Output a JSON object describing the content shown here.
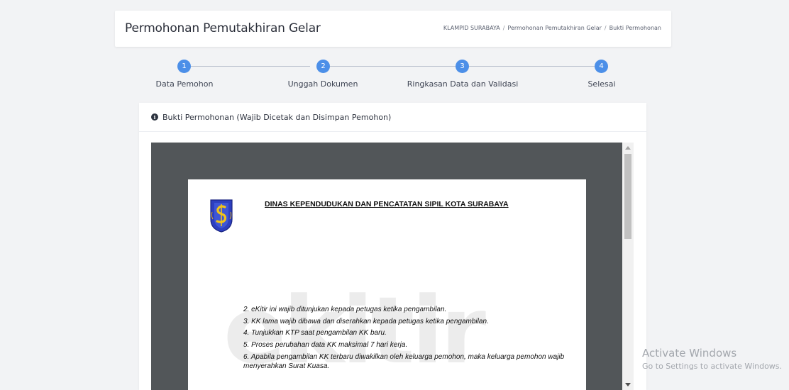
{
  "header": {
    "title": "Permohonan Pemutakhiran Gelar",
    "breadcrumb": [
      "KLAMPID SURABAYA",
      "Permohonan Pemutakhiran Gelar",
      "Bukti Permohonan"
    ],
    "breadcrumb_separator": "/"
  },
  "stepper": {
    "steps": [
      {
        "number": "1",
        "label": "Data Pemohon"
      },
      {
        "number": "2",
        "label": "Unggah Dokumen"
      },
      {
        "number": "3",
        "label": "Ringkasan Data dan Validasi"
      },
      {
        "number": "4",
        "label": "Selesai"
      }
    ],
    "active_color": "#4c8fe8"
  },
  "card": {
    "icon": "info-circle-icon",
    "title": "Bukti Permohonan (Wajib Dicetak dan Disimpan Pemohon)"
  },
  "document": {
    "heading": "DINAS KEPENDUDUKAN DAN PENCATATAN SIPIL KOTA SURABAYA",
    "watermark": "ekitir",
    "notes": [
      "2. eKitir ini wajib ditunjukan kepada petugas ketika pengambilan.",
      "3. KK lama wajib dibawa dan diserahkan kepada petugas ketika pengambilan.",
      "4. Tunjukkan KTP saat pengambilan KK baru.",
      "5. Proses perubahan data KK maksimal 7 hari kerja.",
      "6. Apabila pengambilan KK terbaru diwakilkan oleh keluarga pemohon, maka keluarga pemohon wajib menyerahkan Surat Kuasa."
    ]
  },
  "system_overlay": {
    "title": "Activate Windows",
    "subtitle": "Go to Settings to activate Windows."
  }
}
